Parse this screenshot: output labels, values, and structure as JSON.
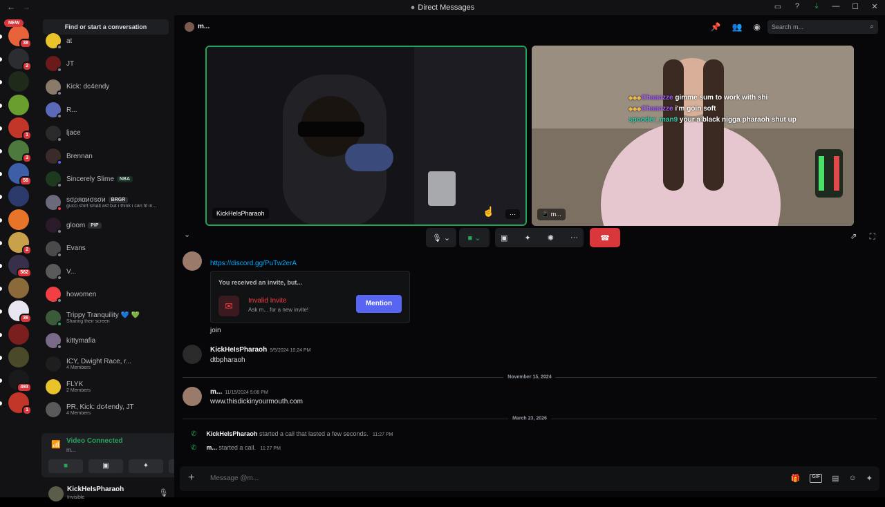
{
  "window": {
    "title": "Direct Messages",
    "nav_back": "←",
    "nav_forward": "→",
    "controls": [
      "▭",
      "?",
      "⤓",
      "—",
      "☐",
      "✕"
    ]
  },
  "servers": {
    "new_label": "NEW",
    "items": [
      {
        "color": "#e8623a",
        "badge": "38"
      },
      {
        "color": "#2b2d31",
        "badge": "2"
      },
      {
        "color": "#1f2a1a",
        "badge": ""
      },
      {
        "color": "#6a9e2f",
        "badge": ""
      },
      {
        "color": "#c2362a",
        "badge": "1"
      },
      {
        "color": "#4d7a3c",
        "badge": "3"
      },
      {
        "color": "#3d5fa8",
        "badge": "58"
      },
      {
        "color": "#2b3a6a",
        "badge": ""
      },
      {
        "color": "#e8742a",
        "badge": ""
      },
      {
        "color": "#c9a14a",
        "badge": "2"
      },
      {
        "color": "#3a2f4a",
        "badge": "562"
      },
      {
        "color": "#8a6a3a",
        "badge": ""
      },
      {
        "color": "#e9e5f0",
        "badge": "36"
      },
      {
        "color": "#7a1e1e",
        "badge": ""
      },
      {
        "color": "#4a4a2a",
        "badge": ""
      },
      {
        "color": "#1a1a1a",
        "badge": "493"
      },
      {
        "color": "#c2362a",
        "badge": "1"
      }
    ]
  },
  "dm_list": {
    "find_placeholder": "Find or start a conversation",
    "items": [
      {
        "name": "at",
        "sub": "",
        "tag": "",
        "color": "#e8c32a",
        "status": "#80848e"
      },
      {
        "name": "JT",
        "sub": "",
        "tag": "",
        "color": "#6a1a1a",
        "status": "#80848e"
      },
      {
        "name": "Kick: dc4endy",
        "sub": "",
        "tag": "",
        "color": "#8a7a6a",
        "status": "#80848e"
      },
      {
        "name": "R...",
        "sub": "",
        "tag": "",
        "color": "#5a6ab8",
        "status": "#80848e"
      },
      {
        "name": "ljace",
        "sub": "",
        "tag": "",
        "color": "#2a2a2a",
        "status": "#80848e"
      },
      {
        "name": "Brennan",
        "sub": "",
        "tag": "",
        "color": "#3a2a2a",
        "status": "#5865f2"
      },
      {
        "name": "Sincerely Slime",
        "sub": "",
        "tag": "NBA",
        "color": "#1e3a1e",
        "status": "#80848e"
      },
      {
        "name": "ѕσρяαиσѕσи",
        "sub": "gucci shirt small asf but i think i can fit in...",
        "tag": "BRGR",
        "color": "#6a6a7a",
        "status": "#f23f43"
      },
      {
        "name": "gloom",
        "sub": "",
        "tag": "PIP",
        "color": "#2a1a2a",
        "status": "#80848e"
      },
      {
        "name": "Evans",
        "sub": "",
        "tag": "",
        "color": "#4a4a4a",
        "status": "#80848e"
      },
      {
        "name": "V...",
        "sub": "",
        "tag": "",
        "color": "#5a5a5a",
        "status": "#80848e"
      },
      {
        "name": "howomen",
        "sub": "",
        "tag": "",
        "color": "#f23f43",
        "status": "#80848e"
      },
      {
        "name": "Trippy Tranquility 💙 💚",
        "sub": "Sharing their screen",
        "tag": "",
        "color": "#3a5a3a",
        "status": "#23a55a"
      },
      {
        "name": "kittymafia",
        "sub": "",
        "tag": "",
        "color": "#7a6a8a",
        "status": "#80848e"
      },
      {
        "name": "ICY, Dwight Race, r...",
        "sub": "4 Members",
        "tag": "",
        "color": "#1e1e1e",
        "status": ""
      },
      {
        "name": "FLYK",
        "sub": "2 Members",
        "tag": "",
        "color": "#e8c32a",
        "status": ""
      },
      {
        "name": "PR, Kick: dc4endy, JT",
        "sub": "4 Members",
        "tag": "",
        "color": "#5a5a5a",
        "status": ""
      }
    ]
  },
  "voice": {
    "status": "Video Connected",
    "channel": "m...",
    "signal_icon": "📶",
    "wave_icon": "╫",
    "hangup_icon": "☎",
    "buttons": [
      "■",
      "▣",
      "✦",
      "✺"
    ]
  },
  "user": {
    "name": "KickHeIsPharaoh",
    "status": "Invisible",
    "mic_icon": "🎙",
    "headset_icon": "🎧",
    "settings_icon": "⚙"
  },
  "header": {
    "name": "m...",
    "search_placeholder": "Search m...",
    "icons": [
      "📌",
      "👥",
      "◉"
    ]
  },
  "call": {
    "tile1_name": "KickHeIsPharaoh",
    "tile1_more": "···",
    "tile2_name": "m...",
    "overlay": [
      {
        "user": "Chaanzze",
        "text": "gimme sum to work with shi",
        "cls": "u1",
        "icons": "◆◆◆"
      },
      {
        "user": "Chaanzze",
        "text": "i'm goin soft",
        "cls": "u1",
        "icons": "◆◆◆"
      },
      {
        "user": "spooder_man9",
        "text": "your a black nigga pharaoh shut up",
        "cls": "u2",
        "icons": ""
      }
    ],
    "controls": {
      "mic": "🎙 ⌄",
      "camera": "■ ⌄",
      "screen": "▣",
      "activity": "✦",
      "soundboard": "✺",
      "more": "···",
      "end": "☎"
    },
    "collapse_icon": "⌄",
    "popout_icon": "⇗",
    "fullscreen_icon": "⛶"
  },
  "chat": {
    "link": "https://discord.gg/PuTw2erA",
    "invite": {
      "title": "You received an invite, but...",
      "name": "Invalid Invite",
      "sub": "Ask m... for a new invite!",
      "button": "Mention",
      "icon": "✉"
    },
    "join_text": "join",
    "msg1": {
      "name": "KickHeIsPharaoh",
      "time": "9/5/2024 10:24 PM",
      "text": "dtbpharaoh"
    },
    "divider1": "November 15, 2024",
    "msg2": {
      "name": "m...",
      "time": "11/15/2024 5:08 PM",
      "text": "www.thisdickinyourmouth.com"
    },
    "divider2": "March 23, 2026",
    "call1": {
      "name": "KickHeIsPharaoh",
      "text": "started a call that lasted a few seconds.",
      "time": "11:27 PM"
    },
    "call2": {
      "name": "m...",
      "text": "started a call.",
      "time": "11:27 PM"
    }
  },
  "composer": {
    "placeholder": "Message @m...",
    "plus": "+",
    "icons": [
      "🎁",
      "GIF",
      "▤",
      "☺",
      "✦"
    ]
  }
}
